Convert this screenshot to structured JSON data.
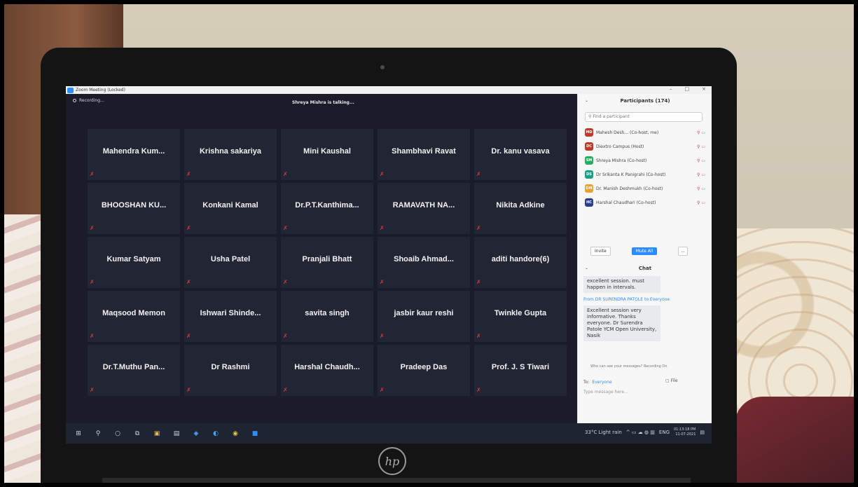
{
  "window": {
    "title": "Zoom Meeting (Locked)"
  },
  "meeting": {
    "recording_label": "Recording...",
    "talking_label": "Shreya Mishra is talking..."
  },
  "tiles": [
    "Mahendra Kum...",
    "Krishna sakariya",
    "Mini Kaushal",
    "Shambhavi Ravat",
    "Dr. kanu vasava",
    "BHOOSHAN KU...",
    "Konkani Kamal",
    "Dr.P.T.Kanthima...",
    "RAMAVATH NA...",
    "Nikita Adkine",
    "Kumar Satyam",
    "Usha Patel",
    "Pranjali Bhatt",
    "Shoaib Ahmad...",
    "aditi handore(6)",
    "Maqsood Memon",
    "Ishwari Shinde...",
    "savita singh",
    "jasbir kaur reshi",
    "Twinkle Gupta",
    "Dr.T.Muthu Pan...",
    "Dr Rashmi",
    "Harshal Chaudh...",
    "Pradeep Das",
    "Prof. J. S Tiwari"
  ],
  "participants": {
    "title": "Participants (174)",
    "search_placeholder": "Find a participant",
    "list": [
      {
        "initials": "MD",
        "name": "Mahesh Desh... (Co-host, me)",
        "color": "#c0392b"
      },
      {
        "initials": "DC",
        "name": "Diextro Campus (Host)",
        "color": "#c0392b"
      },
      {
        "initials": "SM",
        "name": "Shreya Mishra (Co-host)",
        "color": "#27ae60"
      },
      {
        "initials": "DS",
        "name": "Dr Srikanta K Panigrahi (Co-host)",
        "color": "#16a085"
      },
      {
        "initials": "DM",
        "name": "Dr. Manish Deshmukh (Co-host)",
        "color": "#e6a23c"
      },
      {
        "initials": "HC",
        "name": "Harshal Chaudhari (Co-host)",
        "color": "#2c3e91"
      }
    ],
    "invite_label": "Invite",
    "mute_all_label": "Mute All",
    "more_label": "..."
  },
  "chat": {
    "title": "Chat",
    "message_1": "excellent session. must happen in intervals.",
    "from_2": "From DR SURENDRA PATOLE to Everyone",
    "message_2": "Excellent session very informative. Thanks everyone. Dr Surendra Patole YCM Open University, Nasik",
    "hint": "Who can see your messages? Recording On",
    "to_label": "To:",
    "to_value": "Everyone",
    "file_label": "File",
    "input_placeholder": "Type message here..."
  },
  "taskbar": {
    "weather": "33°C Light rain",
    "lang": "ENG",
    "time": "01:13:18 PM",
    "date": "11-07-2021"
  }
}
